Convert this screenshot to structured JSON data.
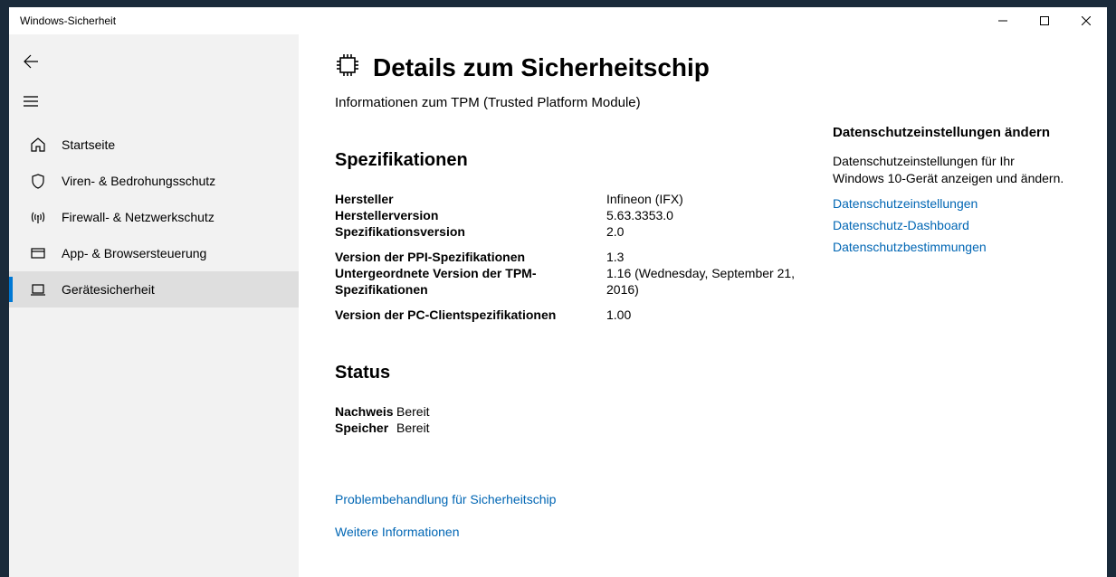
{
  "window": {
    "title": "Windows-Sicherheit"
  },
  "sidebar": {
    "items": [
      {
        "label": "Startseite"
      },
      {
        "label": "Viren- & Bedrohungsschutz"
      },
      {
        "label": "Firewall- & Netzwerkschutz"
      },
      {
        "label": "App- & Browsersteuerung"
      },
      {
        "label": "Gerätesicherheit"
      }
    ]
  },
  "page": {
    "title": "Details zum Sicherheitschip",
    "subtitle": "Informationen zum TPM (Trusted Platform Module)"
  },
  "specs": {
    "heading": "Spezifikationen",
    "rows1": [
      {
        "k": "Hersteller",
        "v": "Infineon (IFX)"
      },
      {
        "k": "Herstellerversion",
        "v": "5.63.3353.0"
      },
      {
        "k": "Spezifikationsversion",
        "v": "2.0"
      }
    ],
    "rows2": [
      {
        "k": "Version der PPI-Spezifikationen",
        "v": "1.3"
      },
      {
        "k": "Untergeordnete Version der TPM-Spezifikationen",
        "v": "1.16 (Wednesday, September 21, 2016)"
      }
    ],
    "rows3": [
      {
        "k": "Version der PC-Clientspezifikationen",
        "v": "1.00"
      }
    ]
  },
  "status": {
    "heading": "Status",
    "rows": [
      {
        "k": "Nachweis",
        "v": "Bereit"
      },
      {
        "k": "Speicher",
        "v": "Bereit"
      }
    ]
  },
  "mainLinks": {
    "troubleshoot": "Problembehandlung für Sicherheitschip",
    "more": "Weitere Informationen"
  },
  "aside": {
    "heading": "Datenschutzeinstellungen ändern",
    "desc": "Datenschutzeinstellungen für Ihr Windows 10-Gerät anzeigen und ändern.",
    "links": {
      "settings": "Datenschutzeinstellungen",
      "dashboard": "Datenschutz-Dashboard",
      "policy": "Datenschutzbestimmungen"
    }
  }
}
